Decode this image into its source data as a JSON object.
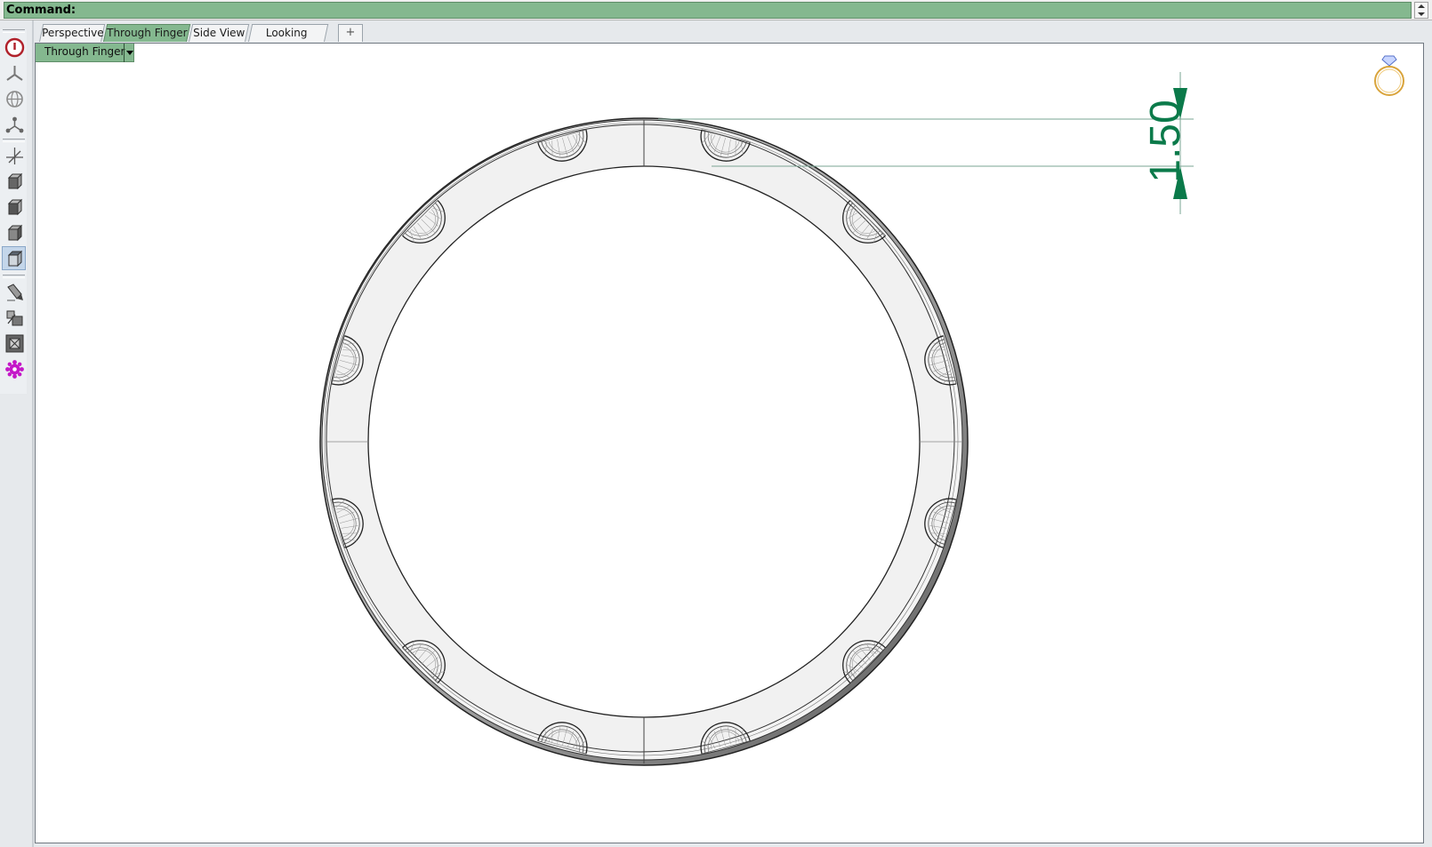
{
  "command": {
    "label": "Command:"
  },
  "tabs": [
    {
      "label": "Perspective",
      "active": false
    },
    {
      "label": "Through Finger",
      "active": true
    },
    {
      "label": "Side View",
      "active": false
    },
    {
      "label": "Looking Down",
      "active": false
    }
  ],
  "add_tab_glyph": "+",
  "viewport": {
    "name": "Through Finger",
    "dimension_value": "1.50"
  },
  "toolbar": {
    "icons": [
      "power-icon",
      "axis-icon",
      "globe-icon",
      "nodes-icon",
      "xyz-axes-icon",
      "box-view-icon",
      "box-front-icon",
      "box-side-icon",
      "box-top-icon",
      "pen-icon",
      "shapes-icon",
      "frame-icon",
      "gear-icon"
    ],
    "active_icon": "box-top-icon"
  },
  "colors": {
    "accent_green": "#84b88f",
    "dimension_green": "#0b7a4a",
    "ring_icon_gold": "#d9a43c"
  }
}
